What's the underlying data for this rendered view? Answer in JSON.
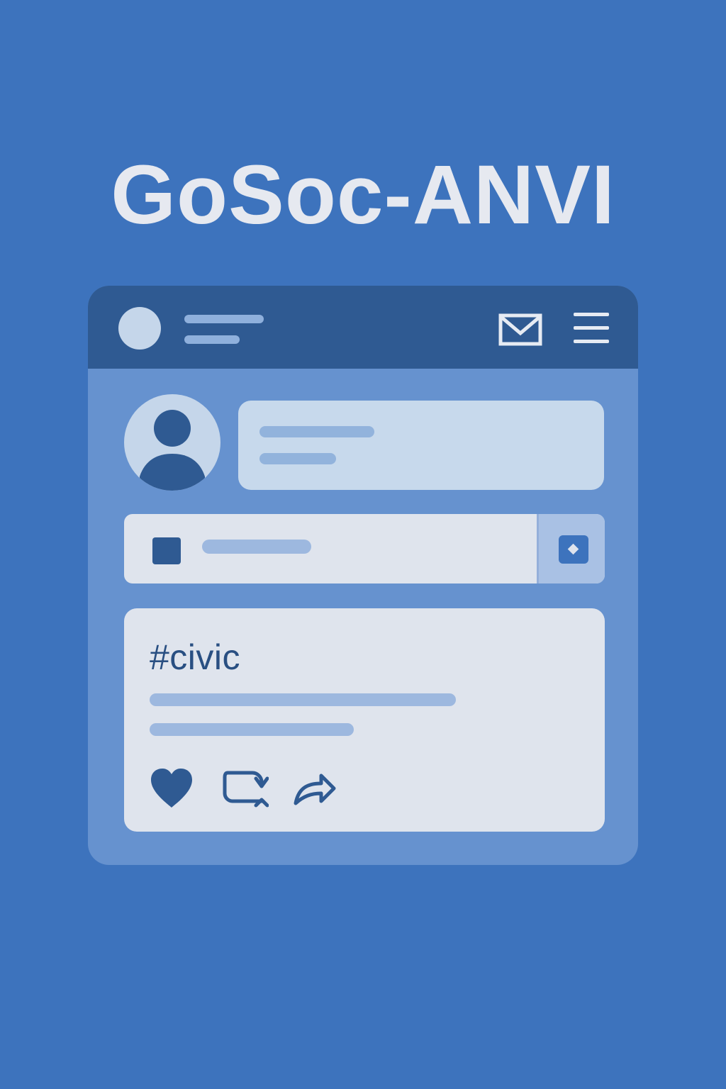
{
  "app": {
    "title": "GoSoc-ANVI"
  },
  "topbar": {
    "icons": [
      "avatar",
      "mail-icon",
      "menu-icon"
    ]
  },
  "post": {
    "hashtag": "#civic",
    "actions": [
      "heart-icon",
      "repost-icon",
      "share-icon"
    ]
  },
  "colors": {
    "background": "#3d73bd",
    "topbar": "#2f5a92",
    "window": "#6692cf",
    "card_light": "#dfe4ed",
    "card_blue": "#c7d9ec",
    "accent_dark": "#2f5a92",
    "placeholder_lines": "#9db8df"
  }
}
